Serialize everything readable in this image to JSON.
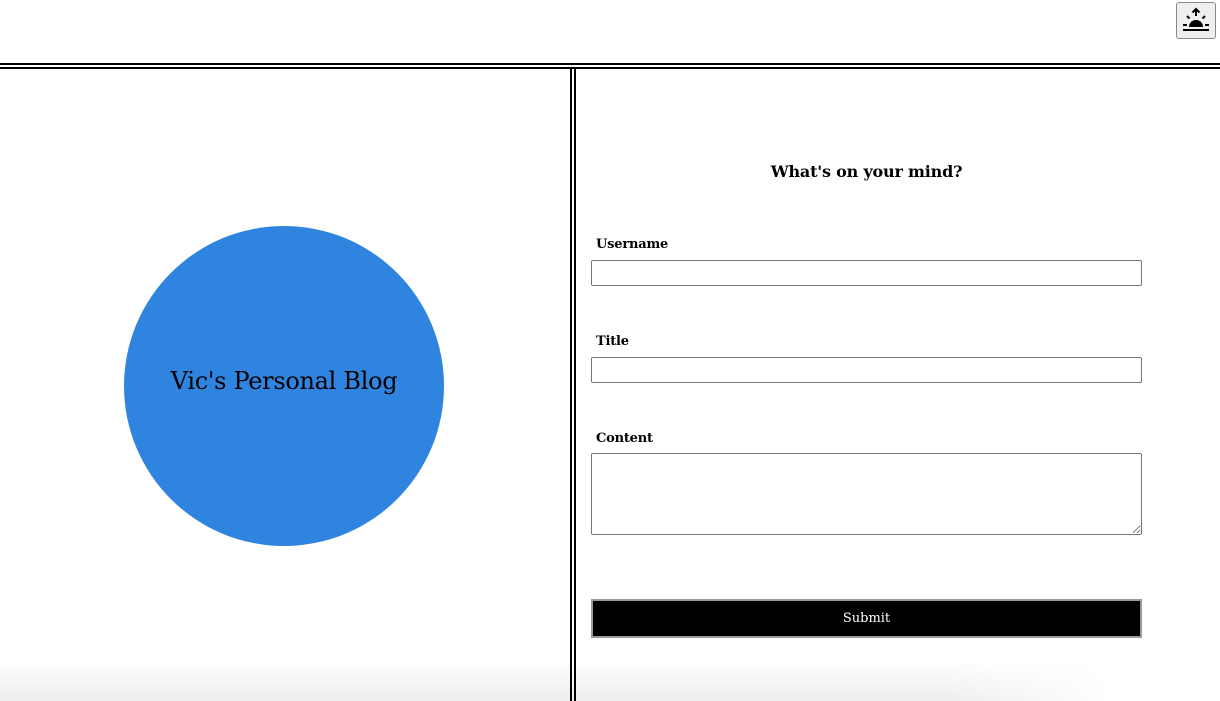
{
  "header": {
    "theme_toggle_icon": "sunrise-icon"
  },
  "blog": {
    "title": "Vic's Personal Blog",
    "circle_color": "#2f84df"
  },
  "form": {
    "title": "What's on your mind?",
    "username_label": "Username",
    "username_value": "",
    "title_label": "Title",
    "title_value": "",
    "content_label": "Content",
    "content_value": "",
    "submit_label": "Submit"
  }
}
